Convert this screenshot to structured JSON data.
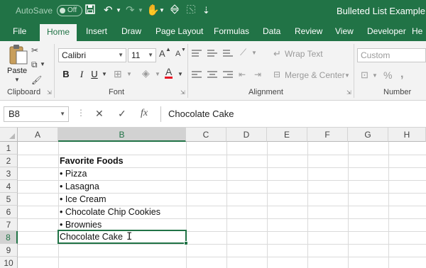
{
  "titlebar": {
    "autosave_label": "AutoSave",
    "autosave_state": "Off",
    "document_title": "Bulleted List Example.xlsx",
    "quick_access": [
      "save-icon",
      "undo-icon",
      "redo-icon",
      "touch-mode-icon",
      "select-icon"
    ]
  },
  "tabs": [
    "File",
    "Home",
    "Insert",
    "Draw",
    "Page Layout",
    "Formulas",
    "Data",
    "Review",
    "View",
    "Developer",
    "He"
  ],
  "ribbon": {
    "clipboard": {
      "paste_label": "Paste",
      "group_label": "Clipboard"
    },
    "font": {
      "font_name": "Calibri",
      "font_size": "11",
      "bold": "B",
      "italic": "I",
      "underline": "U",
      "grow": "A",
      "shrink": "A",
      "font_color_letter": "A",
      "group_label": "Font"
    },
    "alignment": {
      "wrap_text": "Wrap Text",
      "merge_center": "Merge & Center",
      "group_label": "Alignment"
    },
    "number": {
      "format": "Custom",
      "currency": "$",
      "percent": "%",
      "comma": ",",
      "group_label": "Number"
    },
    "colors": {
      "accent": "#217346",
      "font_color_underline": "#e81123"
    }
  },
  "formula_bar": {
    "name_box": "B8",
    "cancel": "✕",
    "enter": "✓",
    "fx": "fx",
    "content": "Chocolate Cake"
  },
  "grid": {
    "columns": [
      "A",
      "B",
      "C",
      "D",
      "E",
      "F",
      "G",
      "H"
    ],
    "rows": [
      "1",
      "2",
      "3",
      "4",
      "5",
      "6",
      "7",
      "8",
      "9",
      "10"
    ],
    "selected_column": "B",
    "selected_row": "8",
    "cells": {
      "B2": "Favorite Foods",
      "B3": "• Pizza",
      "B4": "• Lasagna",
      "B5": "• Ice Cream",
      "B6": "• Chocolate Chip Cookies",
      "B7": "• Brownies",
      "B8": "Chocolate Cake"
    }
  }
}
